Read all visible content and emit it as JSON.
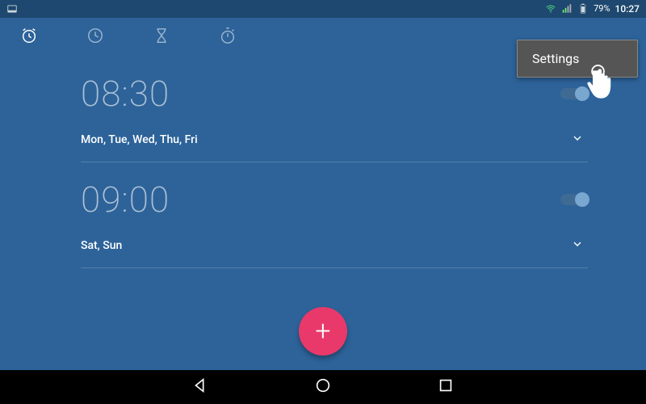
{
  "status": {
    "battery_pct": "79%",
    "clock": "10:27"
  },
  "menu": {
    "settings": "Settings"
  },
  "alarms": [
    {
      "time": "08:30",
      "days": "Mon, Tue, Wed, Thu, Fri",
      "enabled": true
    },
    {
      "time": "09:00",
      "days": "Sat, Sun",
      "enabled": true
    }
  ],
  "colors": {
    "bg": "#2d6399",
    "status_bg": "#1e486f",
    "fab": "#e8396a",
    "menu_bg": "#555555"
  }
}
